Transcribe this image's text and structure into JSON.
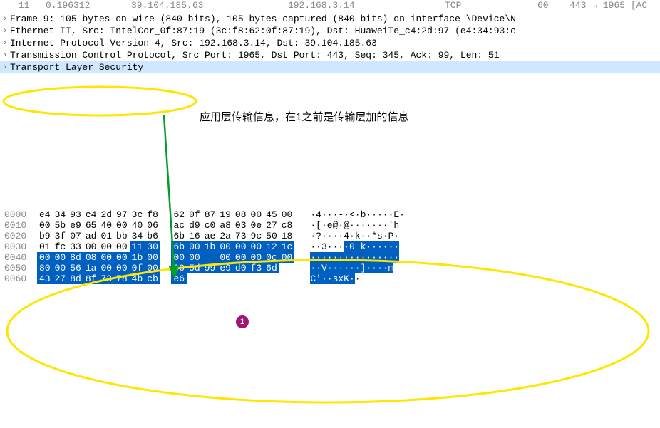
{
  "packet_list": {
    "row": {
      "no": "11",
      "time": "0.196312",
      "src": "39.104.185.63",
      "dst": "192.168.3.14",
      "proto": "TCP",
      "len": "60",
      "info": "443 → 1965 [AC"
    }
  },
  "details": {
    "frame": "Frame 9: 105 bytes on wire (840 bits), 105 bytes captured (840 bits) on interface \\Device\\N",
    "eth": "Ethernet II, Src: IntelCor_0f:87:19 (3c:f8:62:0f:87:19), Dst: HuaweiTe_c4:2d:97 (e4:34:93:c",
    "ip": "Internet Protocol Version 4, Src: 192.168.3.14, Dst: 39.104.185.63",
    "tcp": "Transmission Control Protocol, Src Port: 1965, Dst Port: 443, Seq: 345, Ack: 99, Len: 51",
    "tls": "Transport Layer Security"
  },
  "annotation": {
    "text": "应用层传输信息，在1之前是传输层加的信息",
    "badge": "1"
  },
  "hex": {
    "rows": [
      {
        "off": "0000",
        "bytes": [
          "e4",
          "34",
          "93",
          "c4",
          "2d",
          "97",
          "3c",
          "f8",
          "62",
          "0f",
          "87",
          "19",
          "08",
          "00",
          "45",
          "00"
        ],
        "sel": [
          0,
          0,
          0,
          0,
          0,
          0,
          0,
          0,
          0,
          0,
          0,
          0,
          0,
          0,
          0,
          0
        ],
        "ascii": "·4···-·<·b·····E·"
      },
      {
        "off": "0010",
        "bytes": [
          "00",
          "5b",
          "e9",
          "65",
          "40",
          "00",
          "40",
          "06",
          "ac",
          "d9",
          "c0",
          "a8",
          "03",
          "0e",
          "27",
          "c8"
        ],
        "sel": [
          0,
          0,
          0,
          0,
          0,
          0,
          0,
          0,
          0,
          0,
          0,
          0,
          0,
          0,
          0,
          0
        ],
        "ascii": "·[·e@·@·······'h"
      },
      {
        "off": "0020",
        "bytes": [
          "b9",
          "3f",
          "07",
          "ad",
          "01",
          "bb",
          "34",
          "b6",
          "6b",
          "16",
          "ae",
          "2a",
          "73",
          "9c",
          "50",
          "18"
        ],
        "sel": [
          0,
          0,
          0,
          0,
          0,
          0,
          0,
          0,
          0,
          0,
          0,
          0,
          0,
          0,
          0,
          0
        ],
        "ascii": "·?····4·k··*s·P·"
      },
      {
        "off": "0030",
        "bytes": [
          "01",
          "fc",
          "33",
          "00",
          "00",
          "00",
          "11",
          "30",
          "6b",
          "00",
          "1b",
          "00",
          "00",
          "00",
          "12",
          "1c"
        ],
        "sel": [
          0,
          0,
          0,
          0,
          0,
          0,
          1,
          1,
          1,
          1,
          1,
          1,
          1,
          1,
          1,
          1
        ],
        "ascii": "··3···",
        "ascii_sel": "·0 k······"
      },
      {
        "off": "0040",
        "bytes": [
          "00",
          "00",
          "8d",
          "08",
          "00",
          "00",
          "1b",
          "00",
          "00",
          "00",
          "",
          "00",
          "00",
          "00",
          "0c",
          "00"
        ],
        "sel": [
          1,
          1,
          1,
          1,
          1,
          1,
          1,
          1,
          1,
          1,
          1,
          1,
          1,
          1,
          1,
          1
        ],
        "ascii": "",
        "ascii_sel": "················"
      },
      {
        "off": "0050",
        "bytes": [
          "80",
          "00",
          "56",
          "1a",
          "00",
          "00",
          "0f",
          "00",
          "00",
          "5d",
          "99",
          "e9",
          "d0",
          "f3",
          "6d",
          ""
        ],
        "sel": [
          1,
          1,
          1,
          1,
          1,
          1,
          1,
          1,
          1,
          1,
          1,
          1,
          1,
          1,
          1,
          0
        ],
        "ascii": "",
        "ascii_sel": "··V······]····m"
      },
      {
        "off": "0060",
        "bytes": [
          "43",
          "27",
          "8d",
          "8f",
          "73",
          "78",
          "4b",
          "cb",
          "e6",
          "",
          "",
          "",
          "",
          "",
          "",
          ""
        ],
        "sel": [
          1,
          1,
          1,
          1,
          1,
          1,
          1,
          1,
          1,
          0,
          0,
          0,
          0,
          0,
          0,
          0
        ],
        "ascii": "",
        "ascii_sel": "C'··sxK·",
        "ascii_after": "·"
      }
    ]
  }
}
